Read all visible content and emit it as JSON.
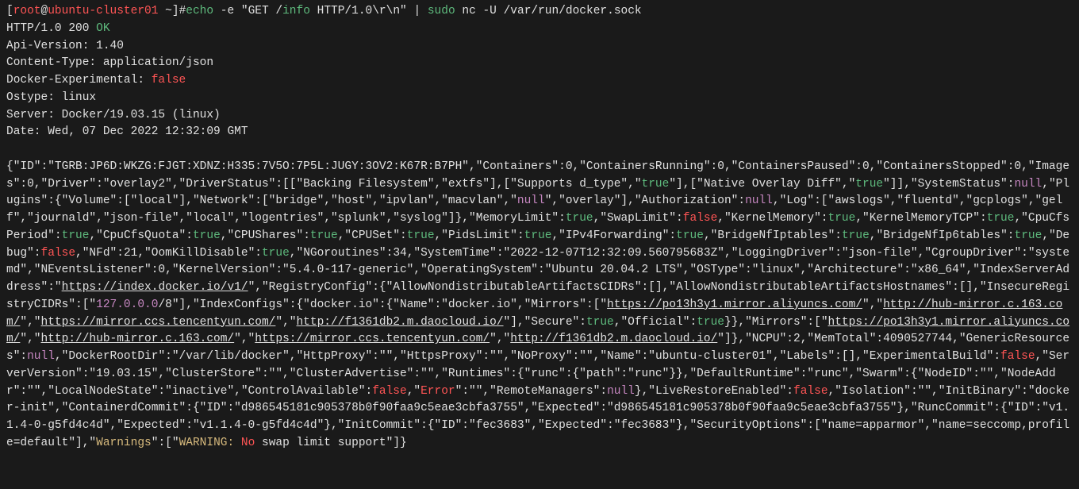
{
  "prompt": {
    "user": "root",
    "host": "ubuntu-cluster01",
    "path": "~",
    "symbol": "#"
  },
  "command": {
    "echo": "echo",
    "flag_e": "-e",
    "get_str_pre": "\"GET /",
    "info_word": "info",
    "get_str_post": " HTTP/1.0\\r\\n\"",
    "pipe": " | ",
    "sudo": "sudo",
    "nc": " nc ",
    "flag_u": "-U",
    "sock": " /var/run/docker.sock"
  },
  "headers": {
    "http": "HTTP/1.0 200 ",
    "ok": "OK",
    "api": "Api-Version: 1.40",
    "ct": "Content-Type: application/json",
    "exp_label": "Docker-Experimental: ",
    "exp_val": "false",
    "ostype": "Ostype: linux",
    "server": "Server: Docker/19.03.15 (linux)",
    "date": "Date: Wed, 07 Dec 2022 12:32:09 GMT"
  },
  "json": {
    "p1": "{\"ID\":\"TGRB:JP6D:WKZG:FJGT:XDNZ:H335:7V5O:7P5L:JUGY:3OV2:K67R:B7PH\",\"Containers\":0,\"ContainersRunning\":0,\"ContainersPaused\":0,\"ContainersStopped\":0,\"Images\":0,\"Driver\":\"overlay2\",\"DriverStatus\":[[\"Backing Filesystem\",\"extfs\"],[\"Supports d_type\",\"",
    "t1": "true",
    "p2": "\"],[\"Native Overlay Diff\",\"",
    "t2": "true",
    "p3": "\"]],\"SystemStatus\":",
    "n1": "null",
    "p4": ",\"Plugins\":{\"Volume\":[\"local\"],\"Network\":[\"bridge\",\"host\",\"ipvlan\",\"macvlan\",\"",
    "n2": "null",
    "p5": "\",\"overlay\"],\"Authorization\":",
    "n3": "null",
    "p6": ",\"Log\":[\"awslogs\",\"fluentd\",\"gcplogs\",\"gelf\",\"journald\",\"json-file\",\"local\",\"logentries\",\"splunk\",\"syslog\"]},\"MemoryLimit\":",
    "t3": "true",
    "p7": ",\"SwapLimit\":",
    "f1": "false",
    "p8": ",\"KernelMemory\":",
    "t4": "true",
    "p9": ",\"KernelMemoryTCP\":",
    "t5": "true",
    "p10": ",\"CpuCfsPeriod\":",
    "t6": "true",
    "p11": ",\"CpuCfsQuota\":",
    "t7": "true",
    "p12": ",\"CPUShares\":",
    "t8": "true",
    "p13": ",\"CPUSet\":",
    "t9": "true",
    "p14": ",\"PidsLimit\":",
    "t10": "true",
    "p15": ",\"IPv4Forwarding\":",
    "t11": "true",
    "p16": ",\"BridgeNfIptables\":",
    "t12": "true",
    "p17": ",\"BridgeNfIp6tables\":",
    "t13": "true",
    "p18": ",\"Debug\":",
    "f2": "false",
    "p19": ",\"NFd\":21,\"OomKillDisable\":",
    "t14": "true",
    "p20": ",\"NGoroutines\":34,\"SystemTime\":\"2022-12-07T12:32:09.560795683Z\",\"LoggingDriver\":\"json-file\",\"CgroupDriver\":\"systemd\",\"NEventsListener\":0,\"KernelVersion\":\"5.4.0-117-generic\",\"OperatingSystem\":\"Ubuntu 20.04.2 LTS\",\"OSType\":\"linux\",\"Architecture\":\"x86_64\",\"IndexServerAddress\":\"",
    "u1": "https://index.docker.io/v1/",
    "p21": "\",\"RegistryConfig\":{\"AllowNondistributableArtifactsCIDRs\":[],\"AllowNondistributableArtifactsHostnames\":[],\"InsecureRegistryCIDRs\":[\"",
    "ip1": "127.0.0.0",
    "p22": "/8\"],\"IndexConfigs\":{\"docker.io\":{\"Name\":\"docker.io\",\"Mirrors\":[\"",
    "u2": "https://po13h3y1.mirror.aliyuncs.com/",
    "p23": "\",\"",
    "u3": "http://hub-mirror.c.163.com/",
    "p24": "\",\"",
    "u4": "https://mirror.ccs.tencentyun.com/",
    "p25": "\",\"",
    "u5": "http://f1361db2.m.daocloud.io/",
    "p26": "\"],\"Secure\":",
    "t15": "true",
    "p27": ",\"Official\":",
    "t16": "true",
    "p28": "}},\"Mirrors\":[\"",
    "u6": "https://po13h3y1.mirror.aliyuncs.com/",
    "p29": "\",\"",
    "u7": "http://hub-mirror.c.163.com/",
    "p30": "\",\"",
    "u8": "https://mirror.ccs.tencentyun.com/",
    "p31": "\",\"",
    "u9": "http://f1361db2.m.daocloud.io/",
    "p32": "\"]},\"NCPU\":2,\"MemTotal\":4090527744,\"GenericResources\":",
    "n4": "null",
    "p33": ",\"DockerRootDir\":\"/var/lib/docker\",\"HttpProxy\":\"\",\"HttpsProxy\":\"\",\"NoProxy\":\"\",\"Name\":\"ubuntu-cluster01\",\"Labels\":[],\"ExperimentalBuild\":",
    "f3": "false",
    "p34": ",\"ServerVersion\":\"19.03.15\",\"ClusterStore\":\"\",\"ClusterAdvertise\":\"\",\"Runtimes\":{\"runc\":{\"path\":\"runc\"}},\"DefaultRuntime\":\"runc\",\"Swarm\":{\"NodeID\":\"\",\"NodeAddr\":\"\",\"LocalNodeState\":\"inactive\",\"ControlAvailable\":",
    "f4": "false",
    "p35": ",\"",
    "err": "Error",
    "p36": "\":\"\",\"RemoteManagers\":",
    "n5": "null",
    "p37": "},\"LiveRestoreEnabled\":",
    "f5": "false",
    "p38": ",\"Isolation\":\"\",\"InitBinary\":\"docker-init\",\"ContainerdCommit\":{\"ID\":\"d986545181c905378b0f90faa9c5eae3cbfa3755\",\"Expected\":\"d986545181c905378b0f90faa9c5eae3cbfa3755\"},\"RuncCommit\":{\"ID\":\"v1.1.4-0-g5fd4c4d\",\"Expected\":\"v1.1.4-0-g5fd4c4d\"},\"InitCommit\":{\"ID\":\"fec3683\",\"Expected\":\"fec3683\"},\"SecurityOptions\":[\"name=apparmor\",\"name=seccomp,profile=default\"],\"",
    "warn_key": "Warnings",
    "p39": "\":[\"",
    "warn_word": "WARNING:",
    "no": " No",
    "p40": " swap limit support\"]}"
  }
}
